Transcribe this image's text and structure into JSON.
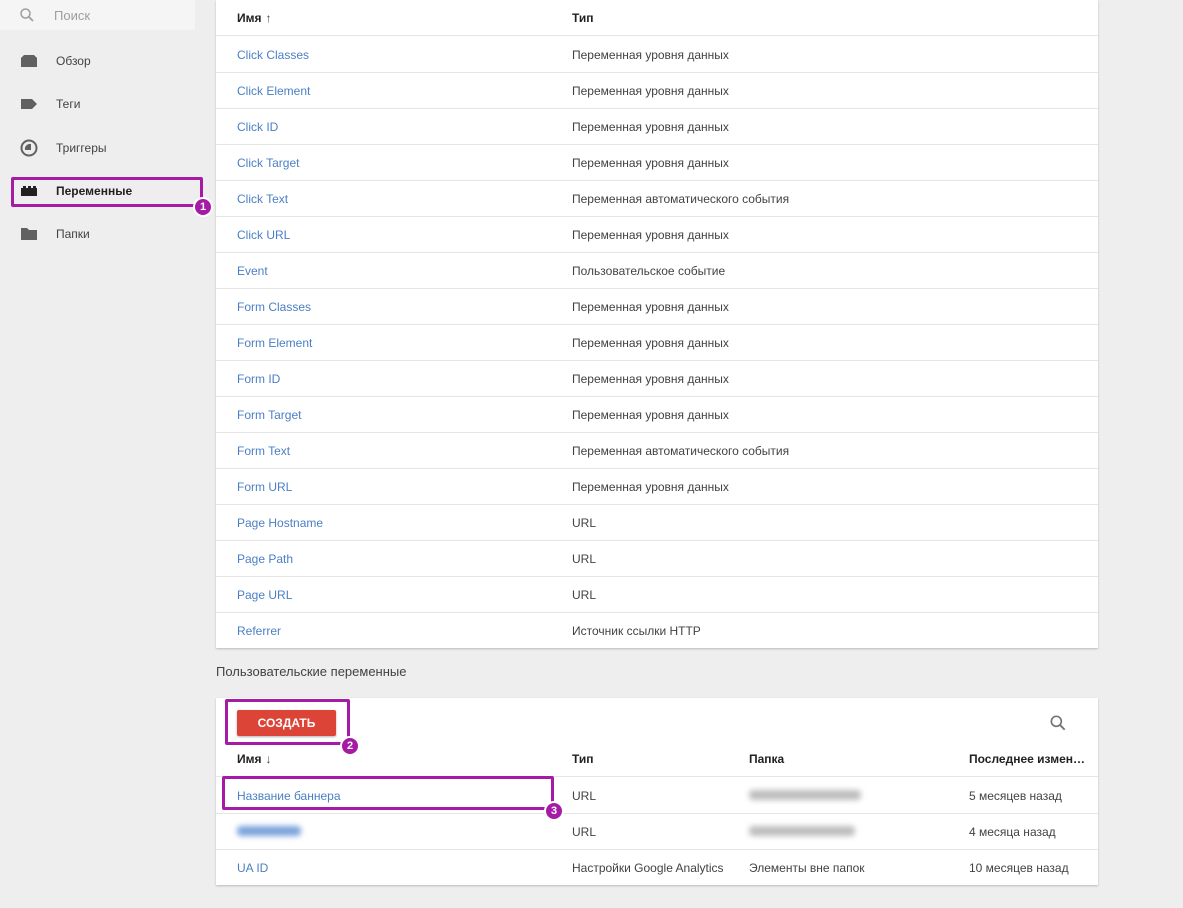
{
  "sidebar": {
    "search_placeholder": "Поиск",
    "items": [
      {
        "label": "Обзор",
        "icon": "overview-icon"
      },
      {
        "label": "Теги",
        "icon": "tag-icon"
      },
      {
        "label": "Триггеры",
        "icon": "trigger-icon"
      },
      {
        "label": "Переменные",
        "icon": "variables-icon",
        "active": true
      },
      {
        "label": "Папки",
        "icon": "folder-icon"
      }
    ]
  },
  "builtin_table": {
    "headers": {
      "name": "Имя",
      "name_sort": "↑",
      "type": "Тип"
    },
    "rows": [
      {
        "name": "Click Classes",
        "type": "Переменная уровня данных"
      },
      {
        "name": "Click Element",
        "type": "Переменная уровня данных"
      },
      {
        "name": "Click ID",
        "type": "Переменная уровня данных"
      },
      {
        "name": "Click Target",
        "type": "Переменная уровня данных"
      },
      {
        "name": "Click Text",
        "type": "Переменная автоматического события"
      },
      {
        "name": "Click URL",
        "type": "Переменная уровня данных"
      },
      {
        "name": "Event",
        "type": "Пользовательское событие"
      },
      {
        "name": "Form Classes",
        "type": "Переменная уровня данных"
      },
      {
        "name": "Form Element",
        "type": "Переменная уровня данных"
      },
      {
        "name": "Form ID",
        "type": "Переменная уровня данных"
      },
      {
        "name": "Form Target",
        "type": "Переменная уровня данных"
      },
      {
        "name": "Form Text",
        "type": "Переменная автоматического события"
      },
      {
        "name": "Form URL",
        "type": "Переменная уровня данных"
      },
      {
        "name": "Page Hostname",
        "type": "URL"
      },
      {
        "name": "Page Path",
        "type": "URL"
      },
      {
        "name": "Page URL",
        "type": "URL"
      },
      {
        "name": "Referrer",
        "type": "Источник ссылки HTTP"
      }
    ]
  },
  "user_section": {
    "title": "Пользовательские переменные",
    "create_label": "СОЗДАТЬ",
    "headers": {
      "name": "Имя",
      "name_sort": "↓",
      "type": "Тип",
      "folder": "Папка",
      "modified": "Последнее измен…"
    },
    "rows": [
      {
        "name": "Название баннера",
        "type": "URL",
        "folder": "",
        "modified": "5 месяцев назад"
      },
      {
        "name": "",
        "type": "URL",
        "folder": "",
        "modified": "4 месяца назад"
      },
      {
        "name": "UA ID",
        "type": "Настройки Google Analytics",
        "folder": "Элементы вне папок",
        "modified": "10 месяцев назад"
      }
    ]
  },
  "annotations": [
    "1",
    "2",
    "3"
  ],
  "colors": {
    "accent_link": "#4a7fc4",
    "highlight": "#a51ba5",
    "create_button": "#db4437"
  }
}
